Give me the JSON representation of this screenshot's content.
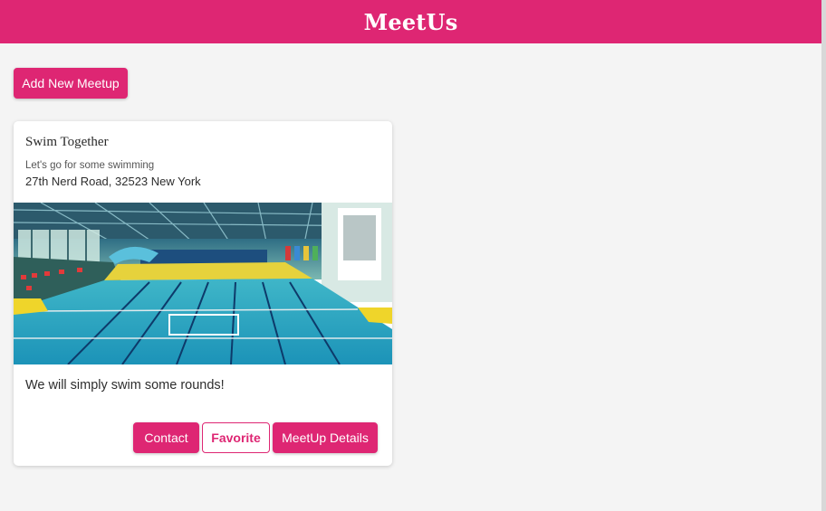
{
  "app": {
    "title": "MeetUs"
  },
  "toolbar": {
    "add_label": "Add New Meetup"
  },
  "meetup": {
    "title": "Swim Together",
    "subtitle": "Let's go for some swimming",
    "address": "27th Nerd Road, 32523 New York",
    "description": "We will simply swim some rounds!",
    "image_content": "indoor-swimming-pool-photo",
    "actions": {
      "contact": "Contact",
      "favorite": "Favorite",
      "details": "MeetUp Details"
    }
  },
  "colors": {
    "accent": "#de2673",
    "background": "#f4f4f4",
    "card": "#ffffff",
    "text": "#2e2e2e"
  }
}
